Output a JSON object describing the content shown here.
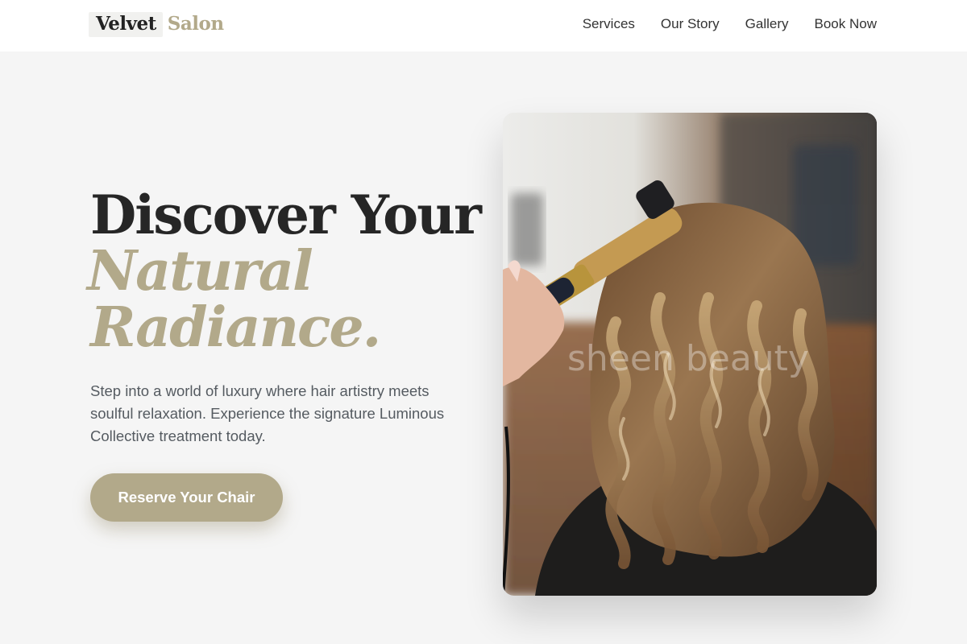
{
  "header": {
    "logo": {
      "word": "Velvet",
      "accent": "Salon"
    },
    "nav": [
      {
        "label": "Services"
      },
      {
        "label": "Our Story"
      },
      {
        "label": "Gallery"
      },
      {
        "label": "Book Now"
      }
    ]
  },
  "hero": {
    "title_line1": "Discover Your",
    "title_line2": "Natural",
    "title_line3": "Radiance.",
    "description": "Step into a world of luxury where hair artistry meets soulful relaxation. Experience the signature Luminous Collective treatment today.",
    "cta_label": "Reserve Your Chair"
  },
  "photo": {
    "watermark": "sheen beauty"
  },
  "colors": {
    "accent": "#b2a98a",
    "heading": "#262626",
    "body_text": "#555b61",
    "background": "#f5f5f5"
  }
}
